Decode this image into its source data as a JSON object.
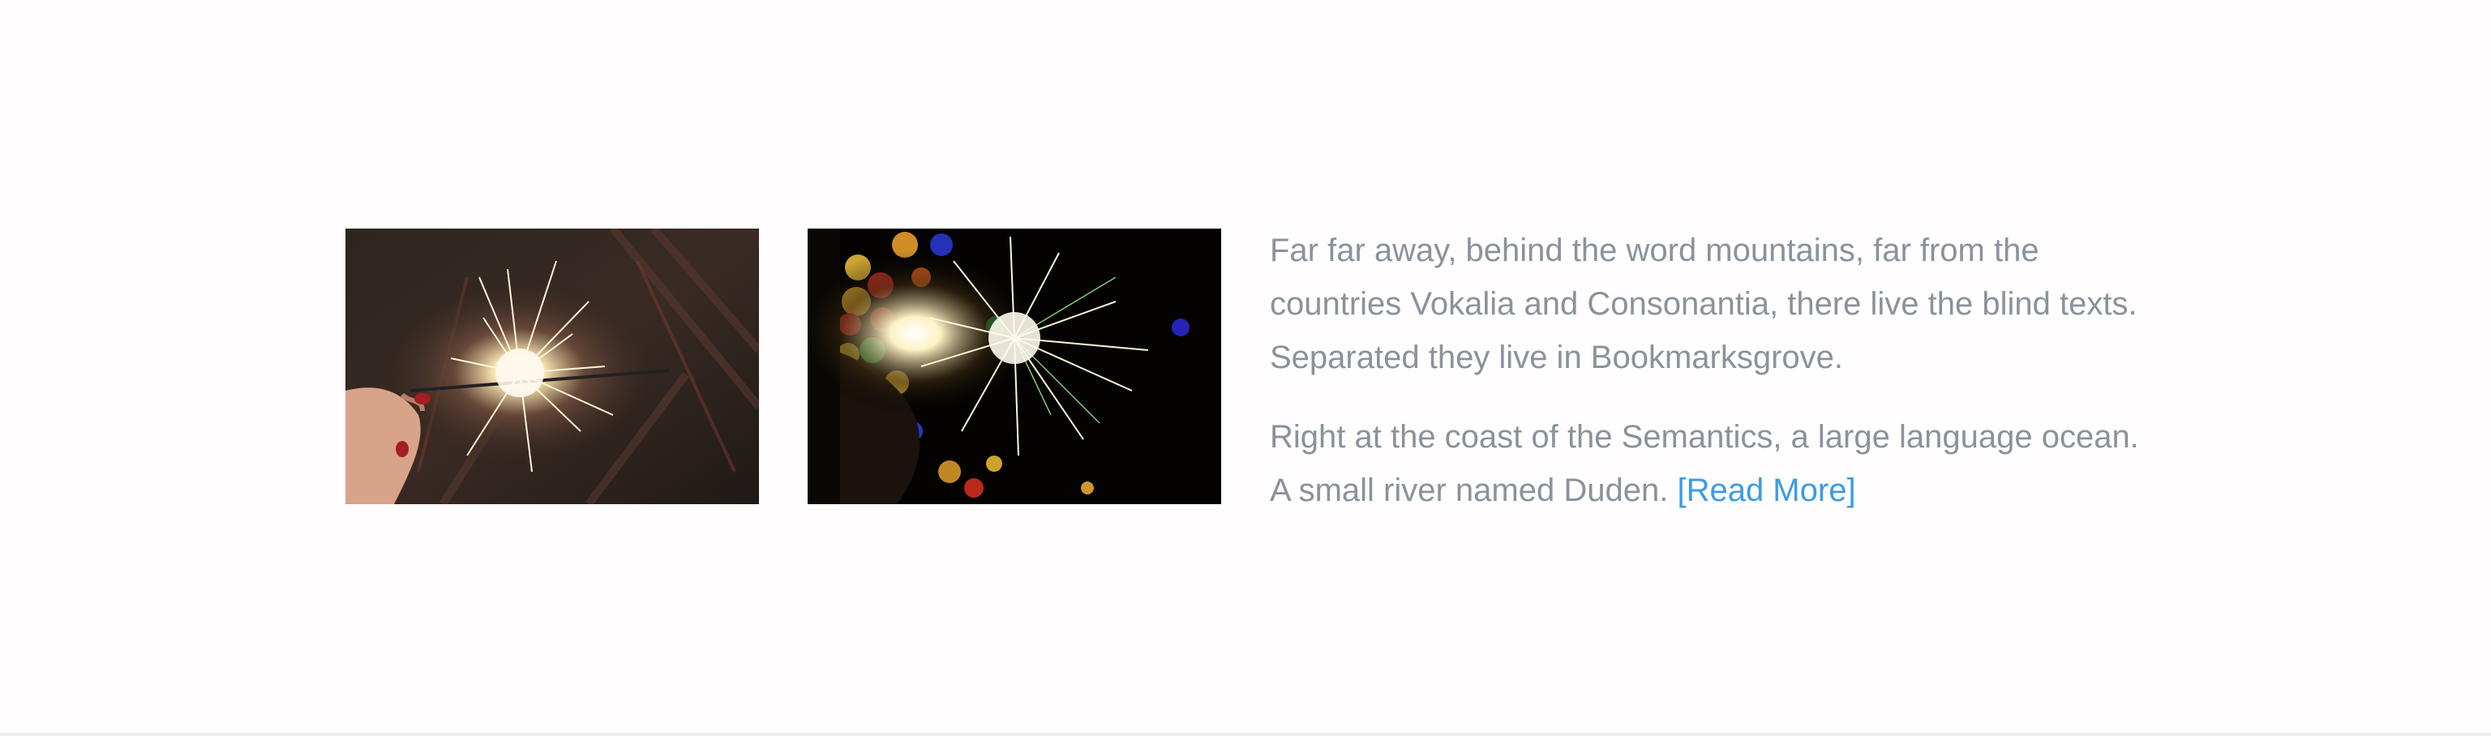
{
  "gallery": {
    "images": [
      {
        "alt": "sparkler-in-hand-photo"
      },
      {
        "alt": "sparkler-with-bokeh-lights-photo"
      }
    ]
  },
  "content": {
    "paragraph_1": "Far far away, behind the word mountains, far from the countries Vokalia and Consonantia, there live the blind texts. Separated they live in Bookmarksgrove.",
    "paragraph_2": "Right at the coast of the Semantics, a large language ocean. A small river named Duden.",
    "read_more_label": "[Read More]"
  },
  "colors": {
    "background": "#fffdfd",
    "text": "#8a929c",
    "link": "#3b9be8"
  }
}
